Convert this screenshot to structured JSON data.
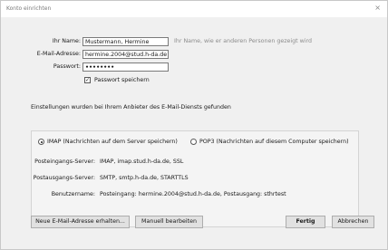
{
  "window": {
    "title": "Konto einrichten",
    "close_glyph": "×"
  },
  "form": {
    "name_label": "Ihr Name:",
    "name_value": "Mustermann, Hermine",
    "name_hint": "Ihr Name, wie er anderen Personen gezeigt wird",
    "email_label": "E-Mail-Adresse:",
    "email_value": "hermine.2004@stud.h-da.de",
    "password_label": "Passwort:",
    "password_value": "••••••••",
    "remember_label": "Passwort speichern",
    "remember_checked": true
  },
  "status_text": "Einstellungen wurden bei Ihrem Anbieter des E-Mail-Diensts gefunden",
  "protocol": {
    "imap_label": "IMAP (Nachrichten auf dem Server speichern)",
    "pop3_label": "POP3 (Nachrichten auf diesem Computer speichern)",
    "selected": "IMAP"
  },
  "servers": {
    "incoming_label": "Posteingangs-Server:",
    "incoming_value": "IMAP, imap.stud.h-da.de, SSL",
    "outgoing_label": "Postausgangs-Server:",
    "outgoing_value": "SMTP, smtp.h-da.de, STARTTLS",
    "username_label": "Benutzername:",
    "username_value": "Posteingang: hermine.2004@stud.h-da.de, Postausgang: sthrtest"
  },
  "buttons": {
    "new_address": "Neue E-Mail-Adresse erhalten...",
    "manual_edit": "Manuell bearbeiten",
    "done": "Fertig",
    "cancel": "Abbrechen"
  }
}
